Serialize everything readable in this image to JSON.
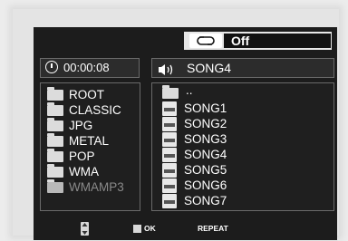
{
  "repeat": {
    "icon": "repeat-icon",
    "value": "Off"
  },
  "status": {
    "time": "00:00:08",
    "track": "SONG4"
  },
  "folders": [
    {
      "name": "ROOT",
      "selected": false
    },
    {
      "name": "CLASSIC",
      "selected": false
    },
    {
      "name": "JPG",
      "selected": false
    },
    {
      "name": "METAL",
      "selected": false
    },
    {
      "name": "POP",
      "selected": false
    },
    {
      "name": "WMA",
      "selected": false
    },
    {
      "name": "WMAMP3",
      "selected": true
    }
  ],
  "files": [
    {
      "name": "..",
      "type": "parent-folder"
    },
    {
      "name": "SONG1",
      "type": "WMA"
    },
    {
      "name": "SONG2",
      "type": "MP3"
    },
    {
      "name": "SONG3",
      "type": "WMA"
    },
    {
      "name": "SONG4",
      "type": "MP3"
    },
    {
      "name": "SONG5",
      "type": "WMA"
    },
    {
      "name": "SONG6",
      "type": "MP3"
    },
    {
      "name": "SONG7",
      "type": "MP3"
    }
  ],
  "bottom": {
    "ok_label": "OK",
    "repeat_label": "REPEAT"
  },
  "colors": {
    "background": "#1c1c1c",
    "text": "#ffffff",
    "dim_text": "#8a8a8a"
  }
}
